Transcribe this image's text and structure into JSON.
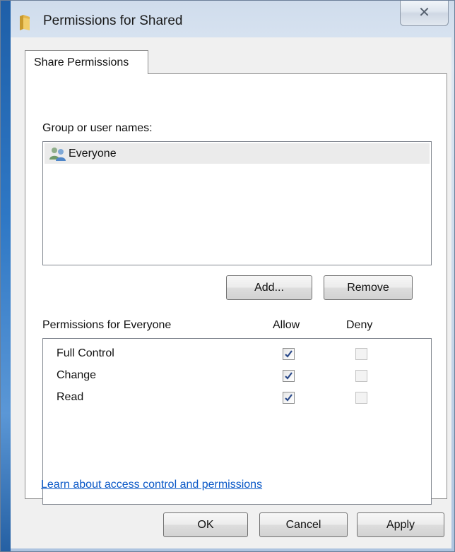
{
  "window": {
    "title": "Permissions for Shared",
    "close_glyph": "✕"
  },
  "tabs": [
    {
      "label": "Share Permissions",
      "selected": true
    }
  ],
  "users": {
    "label": "Group or user names:",
    "items": [
      {
        "name": "Everyone",
        "icon": "users-group-icon",
        "selected": true
      }
    ]
  },
  "buttons": {
    "add": "Add...",
    "remove": "Remove",
    "ok": "OK",
    "cancel": "Cancel",
    "apply": "Apply"
  },
  "permissions": {
    "header": "Permissions for Everyone",
    "allow_label": "Allow",
    "deny_label": "Deny",
    "rows": [
      {
        "name": "Full Control",
        "allow": true,
        "deny": false
      },
      {
        "name": "Change",
        "allow": true,
        "deny": false
      },
      {
        "name": "Read",
        "allow": true,
        "deny": false
      }
    ]
  },
  "help_link": "Learn about access control and permissions",
  "colors": {
    "window_frame": "#cfdcec",
    "link": "#0a58c7",
    "selection": "#ebebeb"
  }
}
